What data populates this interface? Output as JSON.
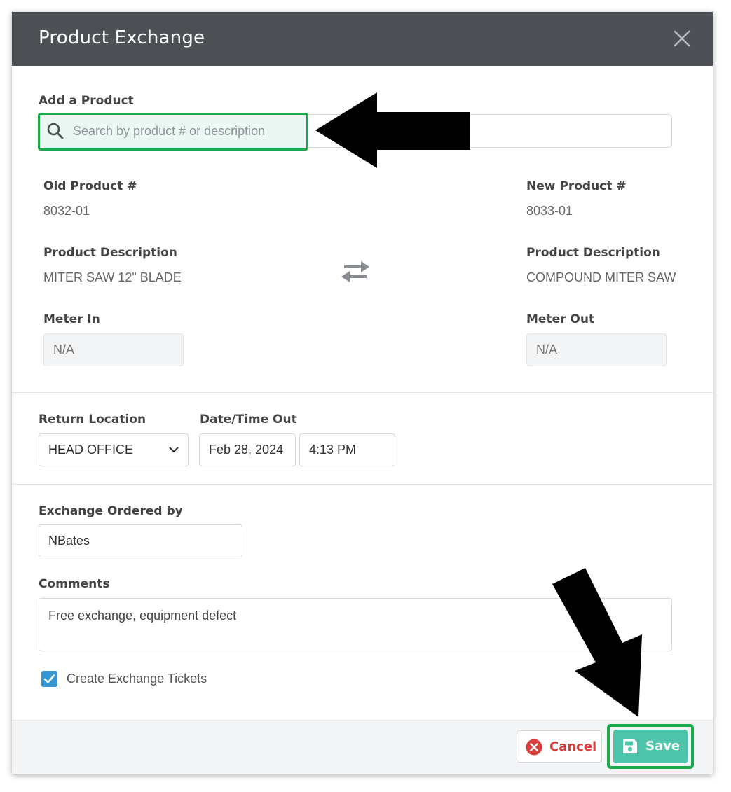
{
  "dialog": {
    "title": "Product Exchange",
    "close_icon": "close-icon"
  },
  "add_product": {
    "label": "Add a Product",
    "placeholder": "Search by product # or description"
  },
  "old_product": {
    "number_label": "Old Product #",
    "number": "8032-01",
    "description_label": "Product Description",
    "description": "MITER SAW 12\" BLADE",
    "meter_label": "Meter In",
    "meter_value": "N/A"
  },
  "new_product": {
    "number_label": "New Product #",
    "number": "8033-01",
    "description_label": "Product Description",
    "description": "COMPOUND MITER SAW",
    "meter_label": "Meter Out",
    "meter_value": "N/A"
  },
  "swap_icon": "exchange-arrows-icon",
  "return_location": {
    "label": "Return Location",
    "value": "HEAD OFFICE"
  },
  "datetime_out": {
    "label": "Date/Time Out",
    "date": "Feb 28, 2024",
    "time": "4:13 PM"
  },
  "ordered_by": {
    "label": "Exchange Ordered by",
    "value": "NBates"
  },
  "comments": {
    "label": "Comments",
    "value": "Free exchange, equipment defect"
  },
  "create_tickets": {
    "label": "Create Exchange Tickets",
    "checked": true
  },
  "footer": {
    "cancel_label": "Cancel",
    "save_label": "Save"
  },
  "colors": {
    "header_bg": "#4d5156",
    "highlight": "#1aaa4b",
    "save_bg": "#4ec4aa",
    "cancel_text": "#d9403b",
    "checkbox": "#3497d3"
  }
}
